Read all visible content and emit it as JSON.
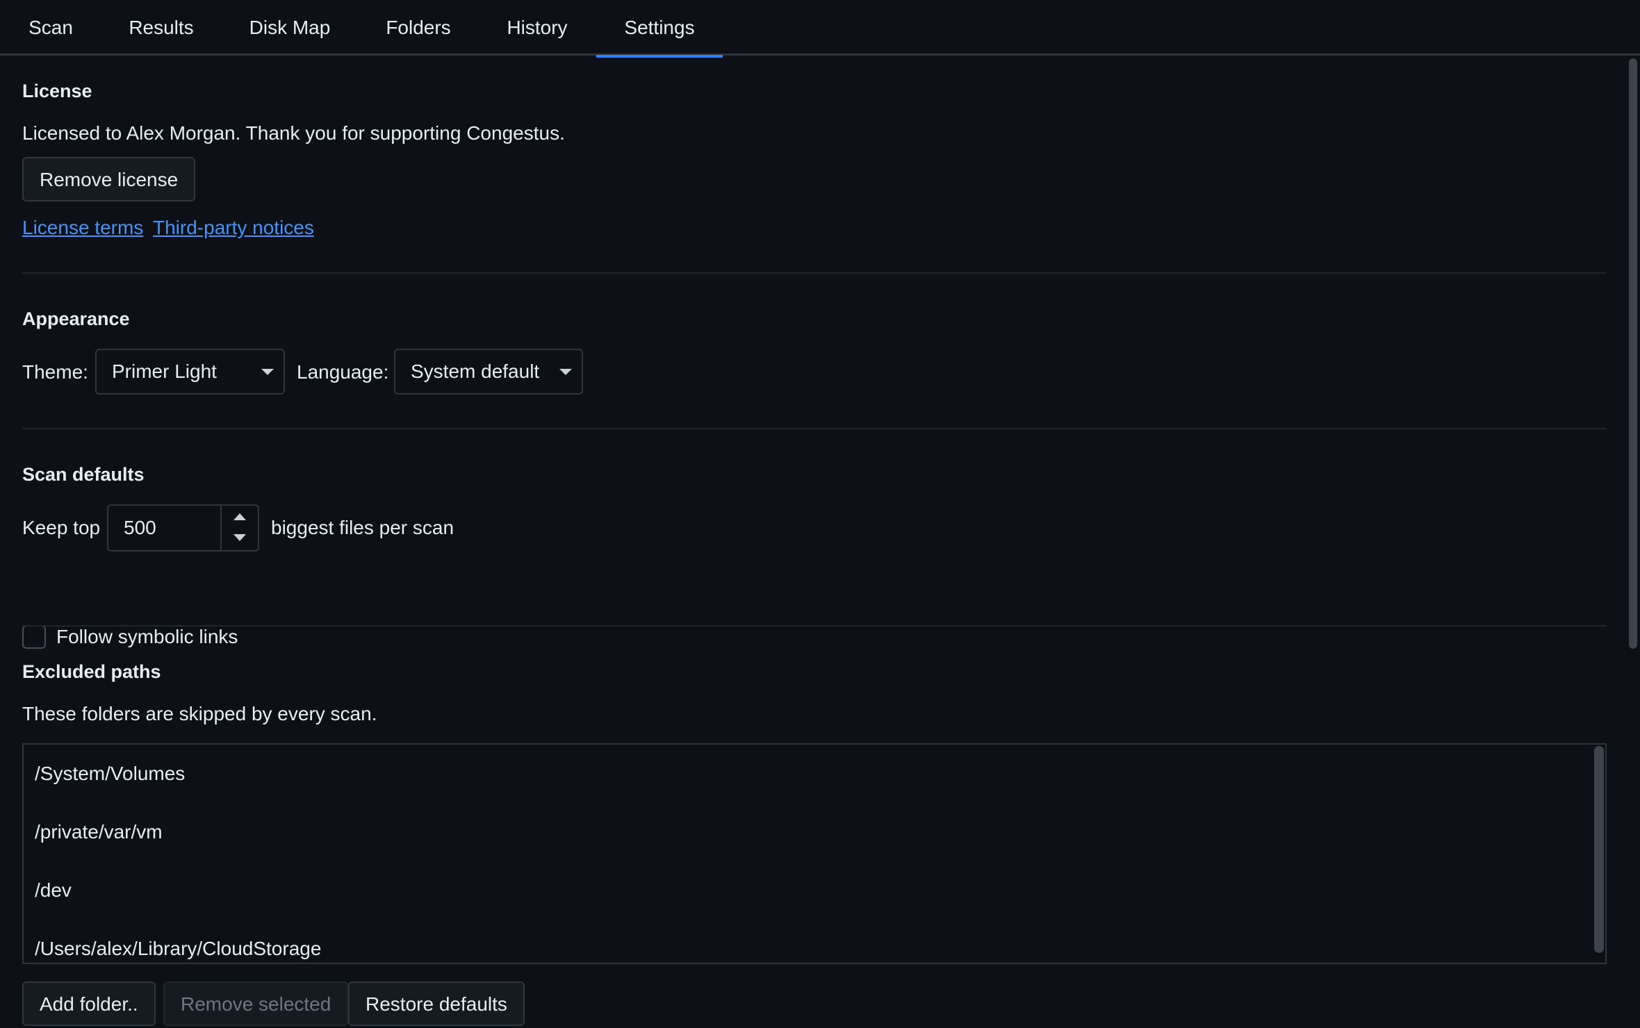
{
  "tabs": [
    "Scan",
    "Results",
    "Disk Map",
    "Folders",
    "History",
    "Settings"
  ],
  "active_tab": "Settings",
  "license": {
    "heading": "License",
    "status": "Licensed to Alex Morgan. Thank you for supporting Congestus.",
    "remove_button": "Remove license",
    "terms_link": "License terms",
    "notices_link": "Third-party notices"
  },
  "appearance": {
    "heading": "Appearance",
    "theme_label": "Theme:",
    "theme_value": "Primer Light",
    "language_label": "Language:",
    "language_value": "System default"
  },
  "scan_defaults": {
    "heading": "Scan defaults",
    "keep_top_label": "Keep top",
    "keep_top_value": "500",
    "keep_top_suffix": "biggest files per scan",
    "follow_symlinks_label": "Follow symbolic links",
    "follow_symlinks_checked": false
  },
  "excluded_paths": {
    "heading": "Excluded paths",
    "description": "These folders are skipped by every scan.",
    "paths": [
      "/System/Volumes",
      "/private/var/vm",
      "/dev",
      "/Users/alex/Library/CloudStorage"
    ],
    "add_button": "Add folder..",
    "remove_button": "Remove selected",
    "restore_button": "Restore defaults"
  },
  "colors": {
    "background": "#0d1117",
    "accent": "#2f81f7",
    "link": "#4493f8",
    "border": "#30363d"
  }
}
